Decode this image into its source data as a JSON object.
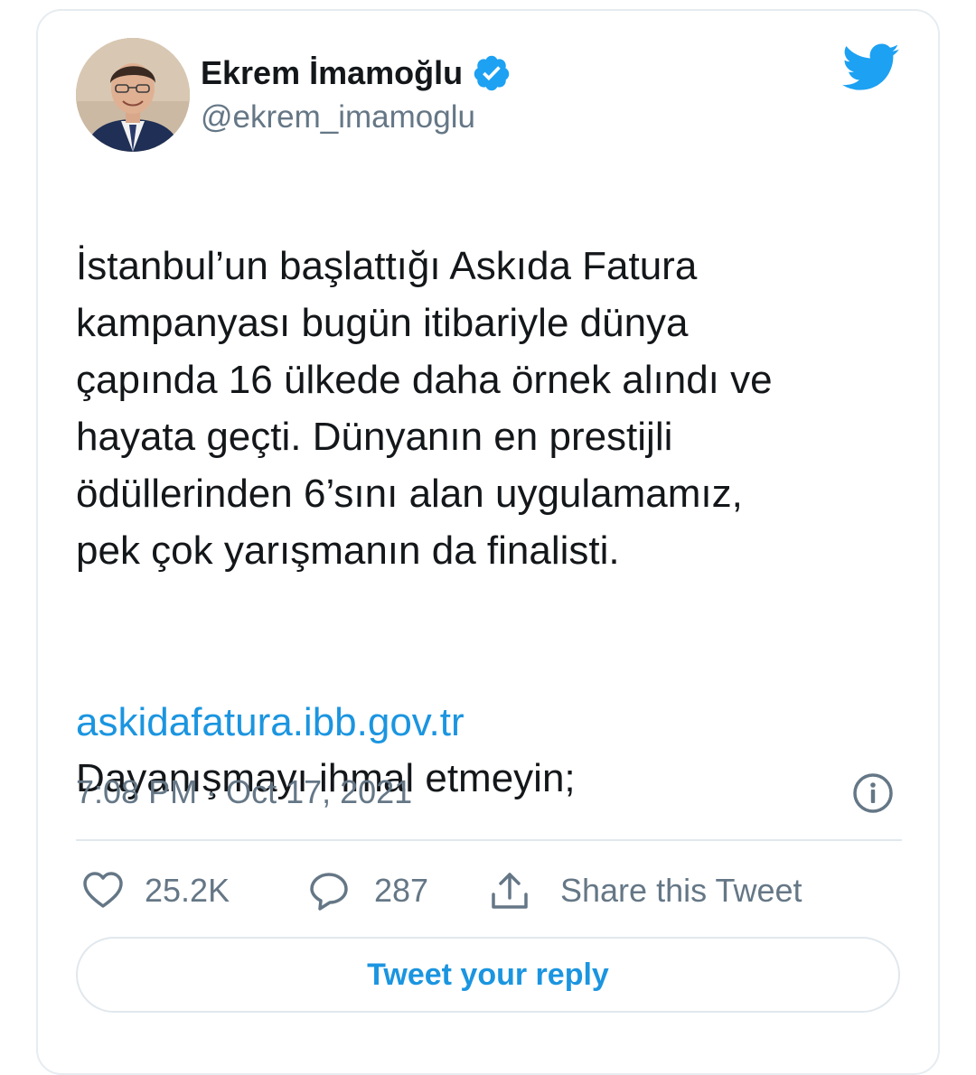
{
  "author": {
    "name": "Ekrem İmamoğlu",
    "handle": "@ekrem_imamoglu",
    "verified_icon": "verified-badge-icon"
  },
  "tweet": {
    "paragraph_1": "İstanbul’un başlattığı Askıda Fatura\nkampanyası bugün itibariyle dünya\nçapında 16 ülkede daha örnek alındı ve\nhayata geçti. Dünyanın en prestijli\nödüllerinden 6’sını alan uygulamamız,\npek çok yarışmanın da finalisti.",
    "paragraph_2": "Dayanışmayı ihmal etmeyin;",
    "link": "askidafatura.ibb.gov.tr",
    "timestamp": "7:08 PM · Oct 17, 2021"
  },
  "actions": {
    "like_count": "25.2K",
    "reply_count": "287",
    "share_label": "Share this Tweet"
  },
  "reply_button_label": "Tweet your reply",
  "colors": {
    "link_blue": "#1b95e0",
    "muted_gray": "#657786",
    "twitter_blue": "#1da1f2",
    "border": "#e1e8ed"
  }
}
